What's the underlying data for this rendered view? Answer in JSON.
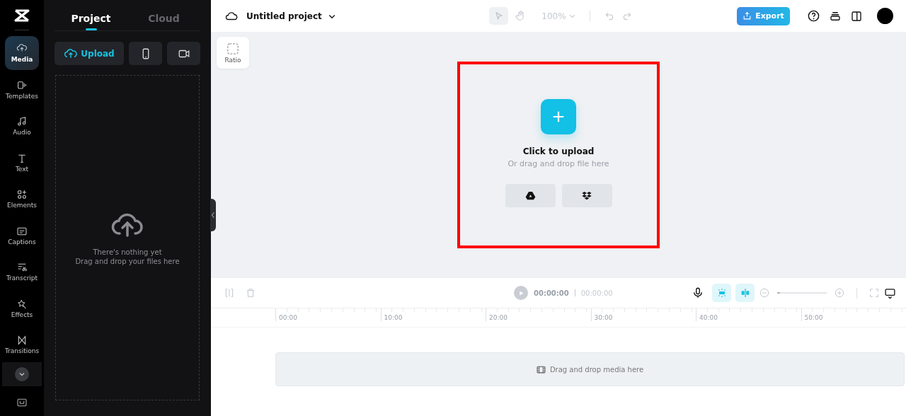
{
  "rail": {
    "items": [
      {
        "label": "Media",
        "selected": true
      },
      {
        "label": "Templates",
        "selected": false
      },
      {
        "label": "Audio",
        "selected": false
      },
      {
        "label": "Text",
        "selected": false
      },
      {
        "label": "Elements",
        "selected": false
      },
      {
        "label": "Captions",
        "selected": false
      },
      {
        "label": "Transcript",
        "selected": false
      },
      {
        "label": "Effects",
        "selected": false
      },
      {
        "label": "Transitions",
        "selected": false
      }
    ]
  },
  "panel": {
    "tabs": [
      {
        "label": "Project",
        "selected": true
      },
      {
        "label": "Cloud",
        "selected": false
      }
    ],
    "upload_button": "Upload",
    "empty_title": "There's nothing yet",
    "empty_hint": "Drag and drop your files here"
  },
  "topbar": {
    "project_name": "Untitled project",
    "zoom": "100%",
    "export": "Export"
  },
  "canvas": {
    "ratio": "Ratio",
    "upload_title": "Click to upload",
    "upload_hint": "Or drag and drop file here",
    "highlighted": true
  },
  "timeline": {
    "current_time": "00:00:00",
    "total_time": "00:00:00",
    "zoom_slider": {
      "level": 0.05
    },
    "ruler": [
      "00:00",
      "10:00",
      "20:00",
      "30:00",
      "40:00",
      "50:00"
    ],
    "track_hint": "Drag and drop media here"
  }
}
